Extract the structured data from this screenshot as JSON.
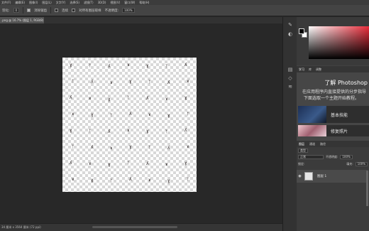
{
  "menubar": [
    "文件(F)",
    "编辑(E)",
    "图像(I)",
    "图层(L)",
    "文字(Y)",
    "选择(S)",
    "滤镜(T)",
    "3D(D)",
    "视图(V)",
    "窗口(W)",
    "帮助(H)"
  ],
  "options": {
    "feather_label": "羽化:",
    "feather_value": "0",
    "antialias_label": "消除锯齿",
    "contiguous_label": "连续",
    "sample_all_label": "对所有图层取样",
    "opacity_label": "不透明度:",
    "opacity_value": "100%"
  },
  "doc_tab": ".png @ 16.7% (图层 1, RGB/8)",
  "status": "34 厘米 x 3564 厘米 (72 ppi)",
  "sidebar_strip_icons": [
    "brush-icon",
    "adjust-icon",
    "layers-icon",
    "path-icon",
    "channels-icon"
  ],
  "learn": {
    "tabs": [
      "学习",
      "库",
      "调整"
    ],
    "title": "了解 Photoshop",
    "desc1": "在应用程序内直接提供的分步指导",
    "desc2": "下面选取一个主题开始教程。",
    "cards": [
      "基本技能",
      "修复照片"
    ]
  },
  "layers": {
    "tabs": [
      "图层",
      "通道",
      "路径"
    ],
    "filter_label": "类型",
    "blend_mode": "正常",
    "opacity_label": "不透明度:",
    "opacity_value": "100%",
    "lock_label": "锁定:",
    "fill_label": "填充:",
    "fill_value": "100%",
    "layer_name": "图层 1"
  },
  "colors": {
    "foreground": "#000000",
    "background": "#ffffff",
    "picker_hue": "#e82c3a"
  }
}
